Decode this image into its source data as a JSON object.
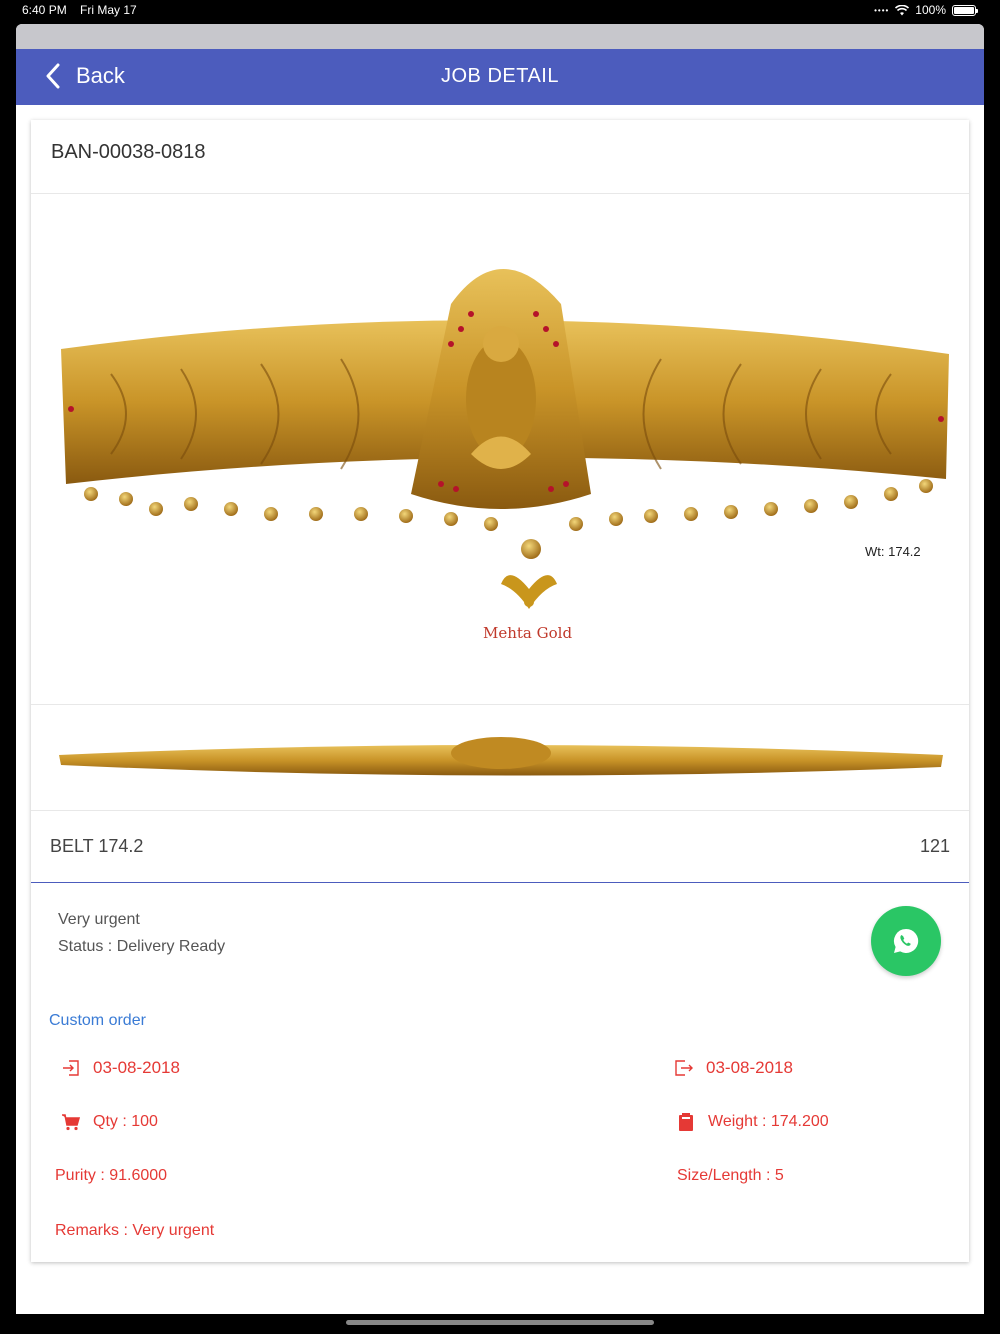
{
  "status_bar": {
    "time": "6:40 PM",
    "date": "Fri May 17",
    "battery": "100%"
  },
  "nav": {
    "back_label": "Back",
    "title": "JOB DETAIL"
  },
  "job": {
    "code": "BAN-00038-0818",
    "image_weight_label": "Wt: 174.2",
    "brand": "Mehta Gold",
    "item_name": "BELT 174.2",
    "item_count": "121",
    "note": "Very urgent",
    "status": "Status : Delivery Ready",
    "order_type": "Custom order",
    "in_date": "03-08-2018",
    "out_date": "03-08-2018",
    "qty": "Qty : 100",
    "weight": "Weight : 174.200",
    "purity": "Purity : 91.6000",
    "size": "Size/Length : 5",
    "remarks": "Remarks : Very urgent"
  },
  "icons": {
    "back": "chevron-left-icon",
    "in": "sign-in-icon",
    "out": "sign-out-icon",
    "qty": "cart-icon",
    "weight": "weight-icon",
    "share": "whatsapp-icon"
  },
  "colors": {
    "nav": "#4c5cbd",
    "accent_red": "#e53935",
    "link_blue": "#3a7bd5",
    "whatsapp": "#2ac665"
  }
}
